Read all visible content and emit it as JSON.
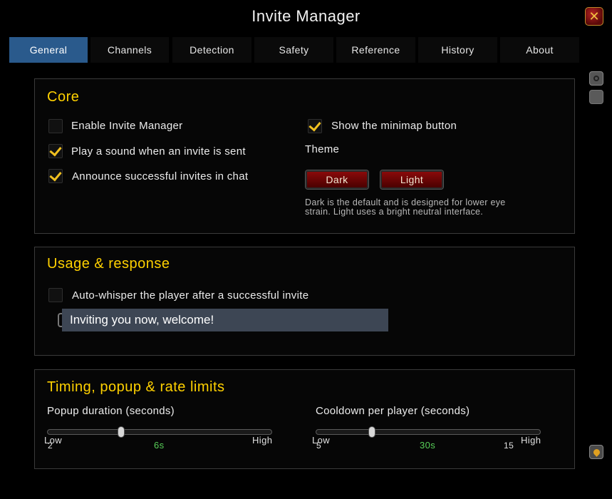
{
  "window": {
    "title": "Invite Manager"
  },
  "tabs": [
    {
      "label": "General",
      "active": true
    },
    {
      "label": "Channels",
      "active": false
    },
    {
      "label": "Detection",
      "active": false
    },
    {
      "label": "Safety",
      "active": false
    },
    {
      "label": "Reference",
      "active": false
    },
    {
      "label": "History",
      "active": false
    },
    {
      "label": "About",
      "active": false
    }
  ],
  "core": {
    "heading": "Core",
    "options": [
      {
        "label": "Enable Invite Manager",
        "checked": false
      },
      {
        "label": "Play a sound when an invite is sent",
        "checked": true
      },
      {
        "label": "Announce successful invites in chat",
        "checked": true
      },
      {
        "label": "Show the minimap button",
        "checked": true
      }
    ],
    "theme_label": "Theme",
    "theme_buttons": [
      "Dark",
      "Light"
    ],
    "theme_desc_line1": "Dark is the default and is designed for lower eye",
    "theme_desc_line2": "strain. Light uses a bright neutral interface."
  },
  "usage": {
    "heading": "Usage & response",
    "auto_whisper_label": "Auto-whisper the player after a successful invite",
    "auto_whisper_checked": false,
    "whisper_text": "Inviting you now, welcome!"
  },
  "timing": {
    "heading": "Timing, popup & rate limits",
    "popup": {
      "label": "Popup duration (seconds)",
      "low": "Low",
      "high": "High",
      "min": "2",
      "value": "6s",
      "level": 0.33
    },
    "cooldown": {
      "label": "Cooldown per player (seconds)",
      "low": "Low",
      "high": "High",
      "min": "5",
      "value": "30s",
      "max": "15",
      "level": 0.25
    }
  },
  "colors": {
    "accent_tab": "#2a5a8c",
    "heading": "#ffd100",
    "value_green": "#58d058",
    "button_red": "#8a0a0a"
  },
  "icons": [
    "close-icon",
    "scroll-up-icon",
    "minimap-pin-icon",
    "checkmark-icon"
  ]
}
